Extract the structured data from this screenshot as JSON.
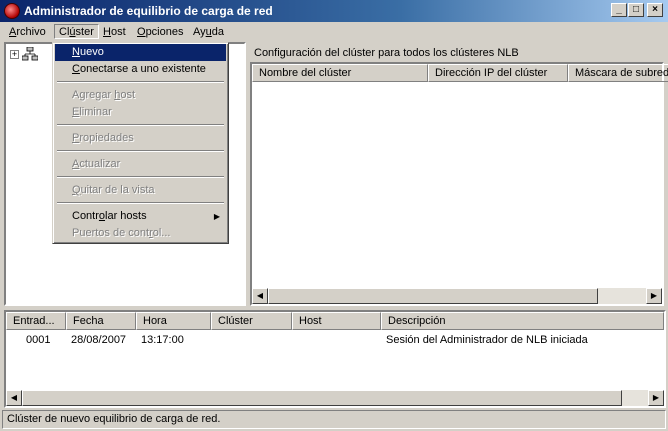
{
  "window": {
    "title": "Administrador de equilibrio de carga de red",
    "min_glyph": "_",
    "max_glyph": "□",
    "close_glyph": "×"
  },
  "menubar": [
    {
      "label_u": "A",
      "label_rest": "rchivo"
    },
    {
      "label_pre": "Cl",
      "label_u": "ú",
      "label_rest": "ster"
    },
    {
      "label_u": "H",
      "label_rest": "ost"
    },
    {
      "label_u": "O",
      "label_rest": "pciones"
    },
    {
      "label_pre": "Ay",
      "label_u": "u",
      "label_rest": "da"
    }
  ],
  "cluster_menu": {
    "items": [
      {
        "label_u": "N",
        "label_rest": "uevo"
      },
      {
        "label_u": "C",
        "label_rest": "onectarse a uno existente"
      },
      {
        "label_pre": "Agregar ",
        "label_u": "h",
        "label_rest": "ost"
      },
      {
        "label_u": "E",
        "label_rest": "liminar"
      },
      {
        "label_u": "P",
        "label_rest": "ropiedades"
      },
      {
        "label_u": "A",
        "label_rest": "ctualizar"
      },
      {
        "label_u": "Q",
        "label_rest": "uitar de la vista"
      },
      {
        "label_pre": "Contr",
        "label_u": "o",
        "label_rest": "lar hosts"
      },
      {
        "label_pre": "Puertos de cont",
        "label_u": "r",
        "label_rest": "ol..."
      }
    ]
  },
  "right_panel": {
    "caption": "Configuración del clúster para todos los clústeres NLB",
    "columns": [
      "Nombre del clúster",
      "Dirección IP del clúster",
      "Máscara de subred"
    ]
  },
  "log": {
    "columns": [
      "Entrad...",
      "Fecha",
      "Hora",
      "Clúster",
      "Host",
      "Descripción"
    ],
    "rows": [
      {
        "entry": "0001",
        "date": "28/08/2007",
        "time": "13:17:00",
        "cluster": "",
        "host": "",
        "description": "Sesión del Administrador de NLB iniciada"
      }
    ]
  },
  "status": {
    "text": "Clúster de nuevo equilibrio de carga de red."
  },
  "colors": {
    "title_start": "#0a246a",
    "title_end": "#a6caf0",
    "selection": "#0a246a",
    "face": "#d4d0c8"
  },
  "icons": {
    "app": "nlb-app-icon",
    "tree_root": "network-cluster-icon",
    "expander": "plus-box-icon"
  }
}
